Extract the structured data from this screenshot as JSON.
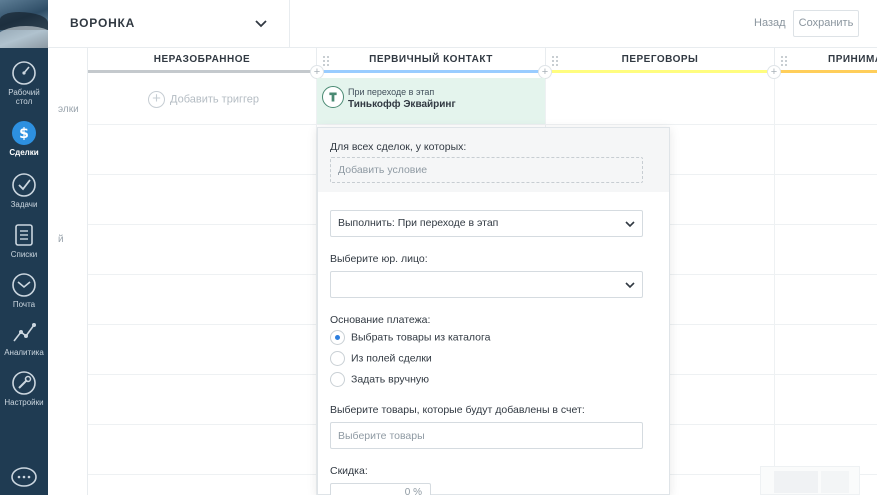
{
  "header": {
    "funnel_title": "ВОРОНКА",
    "back_label": "Назад",
    "save_label": "Сохранить"
  },
  "sidebar": {
    "items": [
      {
        "label": "Рабочий стол",
        "icon": "dashboard-icon",
        "active": false
      },
      {
        "label": "Сделки",
        "icon": "deals-icon",
        "active": true
      },
      {
        "label": "Задачи",
        "icon": "tasks-icon",
        "active": false
      },
      {
        "label": "Списки",
        "icon": "lists-icon",
        "active": false
      },
      {
        "label": "Почта",
        "icon": "mail-icon",
        "active": false
      },
      {
        "label": "Аналитика",
        "icon": "analytics-icon",
        "active": false
      },
      {
        "label": "Настройки",
        "icon": "settings-icon",
        "active": false
      }
    ],
    "bottom_icon": "chat-icon"
  },
  "left_labels": [
    "элки",
    "й"
  ],
  "columns": [
    {
      "title": "НЕРАЗОБРАННОЕ",
      "color": "#c4c9cd"
    },
    {
      "title": "ПЕРВИЧНЫЙ КОНТАКТ",
      "color": "#99ccff"
    },
    {
      "title": "ПЕРЕГОВОРЫ",
      "color": "#fffd7f"
    },
    {
      "title": "ПРИНИМА",
      "color": "#ffce5a"
    }
  ],
  "add_trigger_label": "Добавить триггер",
  "trigger_card": {
    "subtitle": "При переходе в этап",
    "name": "Тинькофф Эквайринг",
    "icon": "tinkoff-icon"
  },
  "panel": {
    "all_deals_label": "Для всех сделок, у которых:",
    "add_condition_label": "Добавить условие",
    "execute_select": "Выполнить: При переходе в этап",
    "legal_entity_label": "Выберите юр. лицо:",
    "legal_entity_value": "",
    "payment_basis_label": "Основание платежа:",
    "payment_options": [
      {
        "label": "Выбрать товары из каталога",
        "selected": true
      },
      {
        "label": "Из полей сделки",
        "selected": false
      },
      {
        "label": "Задать вручную",
        "selected": false
      }
    ],
    "products_label": "Выберите товары, которые будут добавлены в счет:",
    "products_placeholder": "Выберите товары",
    "discount_label": "Скидка:",
    "discount_value": "0 %"
  },
  "colors": {
    "sidebar_bg": "#1f3b52",
    "trigger_bg": "#e4f4ed",
    "radio_accent": "#2d7ede"
  }
}
